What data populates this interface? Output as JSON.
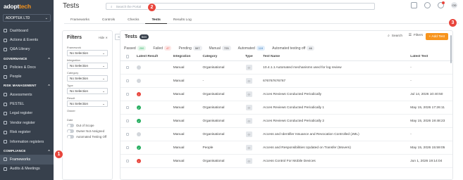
{
  "brand": {
    "part1": "adopt",
    "part2": "tech"
  },
  "org": {
    "name": "ADOPTEK LTD"
  },
  "sidebar": {
    "top": [
      "Dashboard",
      "Actions & Events",
      "Q&A Library"
    ],
    "governance": {
      "title": "GOVERNANCE",
      "items": [
        "Policies & Docs",
        "People"
      ]
    },
    "risk": {
      "title": "RISK MANAGEMENT",
      "items": [
        "Assessments",
        "PESTEL",
        "Legal register",
        "Vendor register",
        "Risk register",
        "Information registers"
      ]
    },
    "compliance": {
      "title": "COMPLIANCE",
      "items": [
        "Frameworks",
        "Audits & Meetings"
      ]
    }
  },
  "header": {
    "title": "Tests",
    "search_placeholder": "Search the Portal",
    "avatar": "OD"
  },
  "tabs": [
    "Frameworks",
    "Controls",
    "Checks",
    "Tests",
    "Results Log"
  ],
  "filters": {
    "title": "Filters",
    "hide": "Hide",
    "framework_label": "Framework",
    "framework_value": "No Selection",
    "integration_label": "Integration",
    "integration_value": "No Selection",
    "category_label": "Category",
    "category_value": "No Selection",
    "type_label": "Type",
    "type_value": "No Selection",
    "result_label": "Result",
    "result_value": "No Selection",
    "owner_label": "Owner",
    "owner_placeholder": "Search users",
    "date_label": "Date",
    "toggle1": "Out of Scope",
    "toggle2": "Owner Not Assigned",
    "toggle3": "Automated Testing Off"
  },
  "panel": {
    "title": "Tests",
    "count": "544",
    "search": "Search",
    "filters": "Filters",
    "add": "+ Add Test"
  },
  "status_tabs": [
    {
      "label": "Passed",
      "count": "200",
      "color": "#27ae60",
      "bg": "#e5f6ea"
    },
    {
      "label": "Failed",
      "count": "47",
      "color": "#e8453c",
      "bg": "#fde8e7"
    },
    {
      "label": "Pending",
      "count": "597",
      "color": "#333",
      "bg": "#eceef1"
    },
    {
      "label": "Manual",
      "count": "725",
      "color": "#333",
      "bg": "#eceef1"
    },
    {
      "label": "Automated",
      "count": "119",
      "color": "#2a6fb0",
      "bg": "#e1eefb"
    },
    {
      "label": "Automated testing off",
      "count": "46",
      "color": "#333",
      "bg": "#eceef1"
    }
  ],
  "columns": [
    "Latest Result",
    "Integration",
    "Category",
    "Type",
    "Test Name",
    "Latest Test"
  ],
  "rows": [
    {
      "result": "na",
      "integration": "Manual",
      "category": "Organisational",
      "name": "10.4.1.1 Automated mechanisms used for log review",
      "date": "-"
    },
    {
      "result": "na",
      "integration": "Manual",
      "category": "-",
      "name": "676767676767",
      "date": "-"
    },
    {
      "result": "fail",
      "integration": "Manual",
      "category": "Organisational",
      "name": "Acces Reviews Conducted Periodically",
      "date": "Jul 14, 2026 10:40:50"
    },
    {
      "result": "pass",
      "integration": "Manual",
      "category": "Organisational",
      "name": "Acces Reviews Conducted Periodically 1",
      "date": "May 15, 2026 17:26:11"
    },
    {
      "result": "pass",
      "integration": "Manual",
      "category": "Organisational",
      "name": "Acces Reviews Conducted Periodically 2",
      "date": "May 15, 2026 19:48:23"
    },
    {
      "result": "na",
      "integration": "Manual",
      "category": "Organisational",
      "name": "Access and Identifier Issuance and Revocation Controlled (JML)",
      "date": "-"
    },
    {
      "result": "pass",
      "integration": "Manual",
      "category": "People",
      "name": "Access and Responsibilities Updated on Transfer (Movers)",
      "date": "May 15, 2026 15:59:05"
    },
    {
      "result": "fail",
      "integration": "Manual",
      "category": "Organisational",
      "name": "Access Control For Mobile Devices",
      "date": "Jun 1, 2026 19:14:04"
    }
  ],
  "annotations": [
    "1",
    "2",
    "3"
  ]
}
